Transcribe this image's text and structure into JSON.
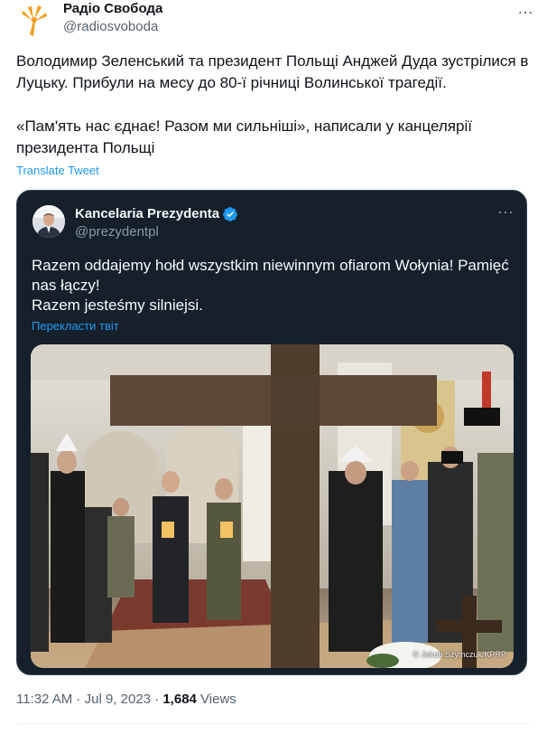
{
  "author": {
    "display_name": "Радіо Свобода",
    "handle": "@radiosvoboda",
    "more_icon": "…"
  },
  "tweet": {
    "paragraph_1": "Володимир Зеленський та президент Польщі Анджей Дуда зустрілися в Луцьку. Прибули на месу до 80-ї річниці Волинської трагедії.",
    "paragraph_2": "«Пам'ять нас єднає! Разом ми сильніші», написали у канцелярії президента Польщі",
    "translate_label": "Translate Tweet"
  },
  "quote": {
    "display_name": "Kancelaria Prezydenta",
    "handle": "@prezydentpl",
    "more_icon": "···",
    "line_1": "Razem oddajemy hołd wszystkim niewinnym ofiarom Wołynia! Pamięć nas łączy!",
    "line_2": "Razem jesteśmy silniejsi.",
    "translate_label": "Перекласти твіт",
    "photo_credit": "© Jakub Szymczuk/KPRP",
    "verified_color": "#1d9bf0"
  },
  "footer": {
    "time": "11:32 AM",
    "separator": " · ",
    "date": "Jul 9, 2023",
    "views_count": "1,684",
    "views_label": " Views"
  },
  "colors": {
    "brand_accent": "#f39c1e",
    "link": "#1d9bf0",
    "card_bg": "#15202b"
  }
}
